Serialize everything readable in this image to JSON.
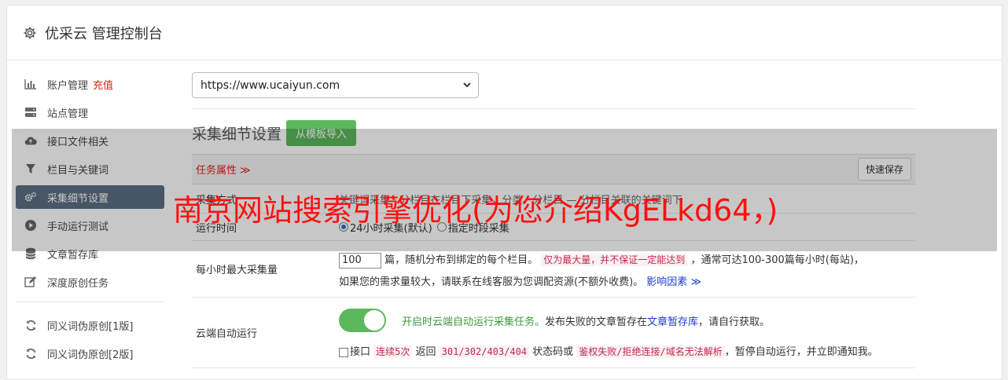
{
  "header": {
    "title": "优采云 管理控制台",
    "icon": "gear-icon"
  },
  "sidebar": {
    "items": [
      {
        "label": "账户管理",
        "extra": "充值",
        "icon": "bar-chart-icon"
      },
      {
        "label": "站点管理",
        "icon": "server-icon"
      },
      {
        "label": "接口文件相关",
        "icon": "cloud-upload-icon"
      },
      {
        "label": "栏目与关键词",
        "icon": "filter-icon"
      },
      {
        "label": "采集细节设置",
        "icon": "gears-icon",
        "active": true
      },
      {
        "label": "手动运行测试",
        "icon": "play-circle-icon"
      },
      {
        "label": "文章暂存库",
        "icon": "database-icon"
      },
      {
        "label": "深度原创任务",
        "icon": "edit-icon"
      },
      {
        "label": "同义词伪原创[1版]",
        "icon": "refresh-icon"
      },
      {
        "label": "同义词伪原创[2版]",
        "icon": "refresh-icon"
      }
    ]
  },
  "main": {
    "site_select": "https://www.ucaiyun.com",
    "section_title": "采集细节设置",
    "import_button": "从模板导入",
    "task_attr": "任务属性 ≫",
    "quick_save": "快速保存",
    "row_mode": {
      "label": "采集方式",
      "value": "关键词采集 · 分栏目在栏目下采集，分类、分栏目 — 分栏目关联的关键词下"
    },
    "row_time": {
      "label": "运行时间",
      "opt1": "24小时采集(默认)",
      "opt2": "指定时段采集"
    },
    "row_max": {
      "label": "每小时最大采集量",
      "input_value": "100",
      "t1": "篇，随机分布到绑定的每个栏目。",
      "t2": "仅为最大量，并不保证一定能达到",
      "t3": "，通常可达100-300篇每小时(每站)，",
      "t4": "如果您的需求量较大，请联系在线客服为您调配资源(不额外收费)。",
      "t5": "影响因素",
      "t6": "≫"
    },
    "row_cloud": {
      "label": "云端自动运行",
      "g1": "开启时云端自动运行采集任务。",
      "t1": "发布失败的文章暂存在",
      "link1": "文章暂存库",
      "t2": "，请自行获取。",
      "c1": "接口",
      "m1": "连续5次",
      "c2": " 返回 ",
      "m2": "301/302/403/404",
      "c3": " 状态码或 ",
      "m3": "鉴权失败/拒绝连接/域名无法解析",
      "c4": "，暂停自动运行，并立即通知我。"
    }
  },
  "overlay_text": "南京网站搜索引擎优化(为您介绍KgELkd64，)",
  "colors": {
    "active_nav": "#5b6f80",
    "green": "#5cb85c",
    "red": "#e02020"
  }
}
